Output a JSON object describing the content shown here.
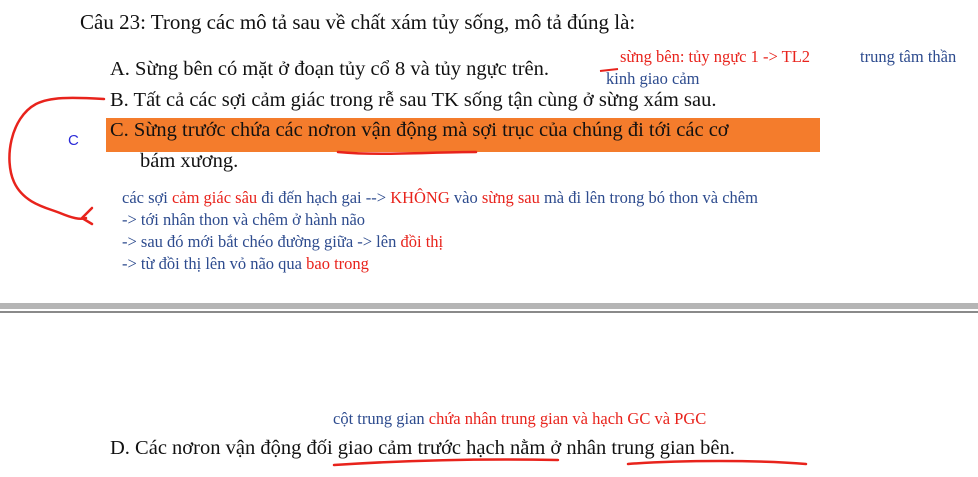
{
  "question": {
    "title": "Câu 23: Trong các mô tả sau về chất xám tủy sống, mô tả đúng là:"
  },
  "options": {
    "a": "A. Sừng bên có mặt ở đoạn tủy cổ 8 và tủy ngực trên.",
    "b": "B. Tất cả các sợi cảm giác trong rễ sau TK sống tận cùng ở sừng xám sau.",
    "c_line1": "C. Sừng trước chứa các nơron vận động mà sợi trục của chúng đi tới các cơ",
    "c_line2": "bám xương.",
    "d": "D. Các nơron vận động đối giao cảm trước hạch nằm ở nhân trung gian bên."
  },
  "notes": {
    "a_red": "sừng bên: tủy ngực 1 -> TL2",
    "a_blue": "trung tâm thần",
    "a_blue2": "kinh giao cảm",
    "c_marker": "C",
    "b1_p1": "các sợi ",
    "b1_p2": "cảm giác sâu",
    "b1_p3": " đi đến hạch gai --> ",
    "b1_p4": "KHÔNG",
    "b1_p5": " vào ",
    "b1_p6": "sừng sau",
    "b1_p7": " mà đi lên trong bó thon và chêm",
    "b2": "-> tới nhân thon và chêm ở hành não",
    "b3_p1": "-> sau đó mới bắt chéo đường giữa -> lên ",
    "b3_p2": "đồi thị",
    "b4_p1": "-> từ đồi thị lên vỏ não qua ",
    "b4_p2": "bao trong",
    "d_p1": "cột trung gian ",
    "d_p2": "chứa nhân trung gian và hạch GC và PGC"
  },
  "colors": {
    "highlight": "#f47c2c",
    "ink_red": "#e8231c",
    "note_blue": "#2d4b8e",
    "marker_blue": "#2a2ad8"
  }
}
